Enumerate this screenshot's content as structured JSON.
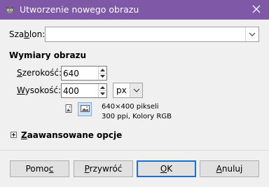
{
  "window": {
    "title": "Utworzenie nowego obrazu"
  },
  "template": {
    "label": "Szablon:",
    "value": ""
  },
  "size_section": {
    "title": "Wymiary obrazu",
    "width_label": "Szerokość:",
    "width_value": "640",
    "height_label": "Wysokość:",
    "height_value": "400",
    "unit": "px",
    "info_line1": "640×400 pikseli",
    "info_line2": "300 ppi, Kolory RGB",
    "orientation_selected": "landscape"
  },
  "advanced": {
    "label": "Zaawansowane opcje",
    "expanded": false
  },
  "buttons": {
    "help": "Pomoc",
    "reset": "Przywróć",
    "ok": "OK",
    "cancel": "Anuluj"
  },
  "colors": {
    "titlebar": "#7f58a8",
    "default_button_border": "#1b6fd0"
  },
  "icons": {
    "app": "gimp-icon",
    "close": "close-icon",
    "portrait": "portrait-icon",
    "landscape": "landscape-icon"
  }
}
